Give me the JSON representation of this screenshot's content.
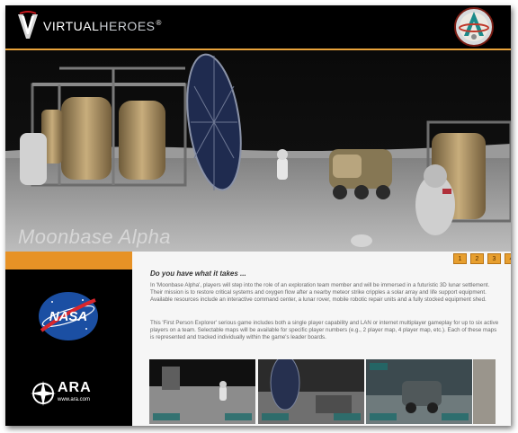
{
  "header": {
    "brand_part1": "VIRTUAL",
    "brand_part2": "HEROES",
    "brand_reg": "®",
    "accent_color": "#e8a23a"
  },
  "hero": {
    "title": "Moonbase Alpha"
  },
  "pager": {
    "pages": [
      "1",
      "2",
      "3",
      "4"
    ],
    "color": "#e79f2f"
  },
  "content": {
    "headline": "Do you have what it takes ...",
    "paragraph1": "In 'Moonbase Alpha', players will step into the role of an exploration team member and will be immersed in a futuristic 3D lunar settlement. Their mission is to restore critical systems and oxygen flow after a nearby meteor strike cripples a solar array and life support equipment. Available resources include an interactive command center, a lunar rover, mobile robotic repair units and a fully stocked equipment shed.",
    "paragraph2": "This 'First Person Explorer' serious game includes both a single player capability and LAN or internet multiplayer gameplay for up to six active players on a team. Selectable maps will be available for specific player numbers (e.g., 2 player map, 4 player map, etc.). Each of these maps is represented and tracked individually within the game's leader boards."
  },
  "partners": {
    "nasa": "NASA",
    "ara": "ARA",
    "ara_url": "www.ara.com"
  },
  "icons": [
    "virtual-heroes-logo-icon",
    "mission-patch-icon",
    "nasa-logo-icon",
    "ara-compass-icon"
  ],
  "colors": {
    "orange_band": "#e79226",
    "panel_bg": "#f6f6f6"
  }
}
